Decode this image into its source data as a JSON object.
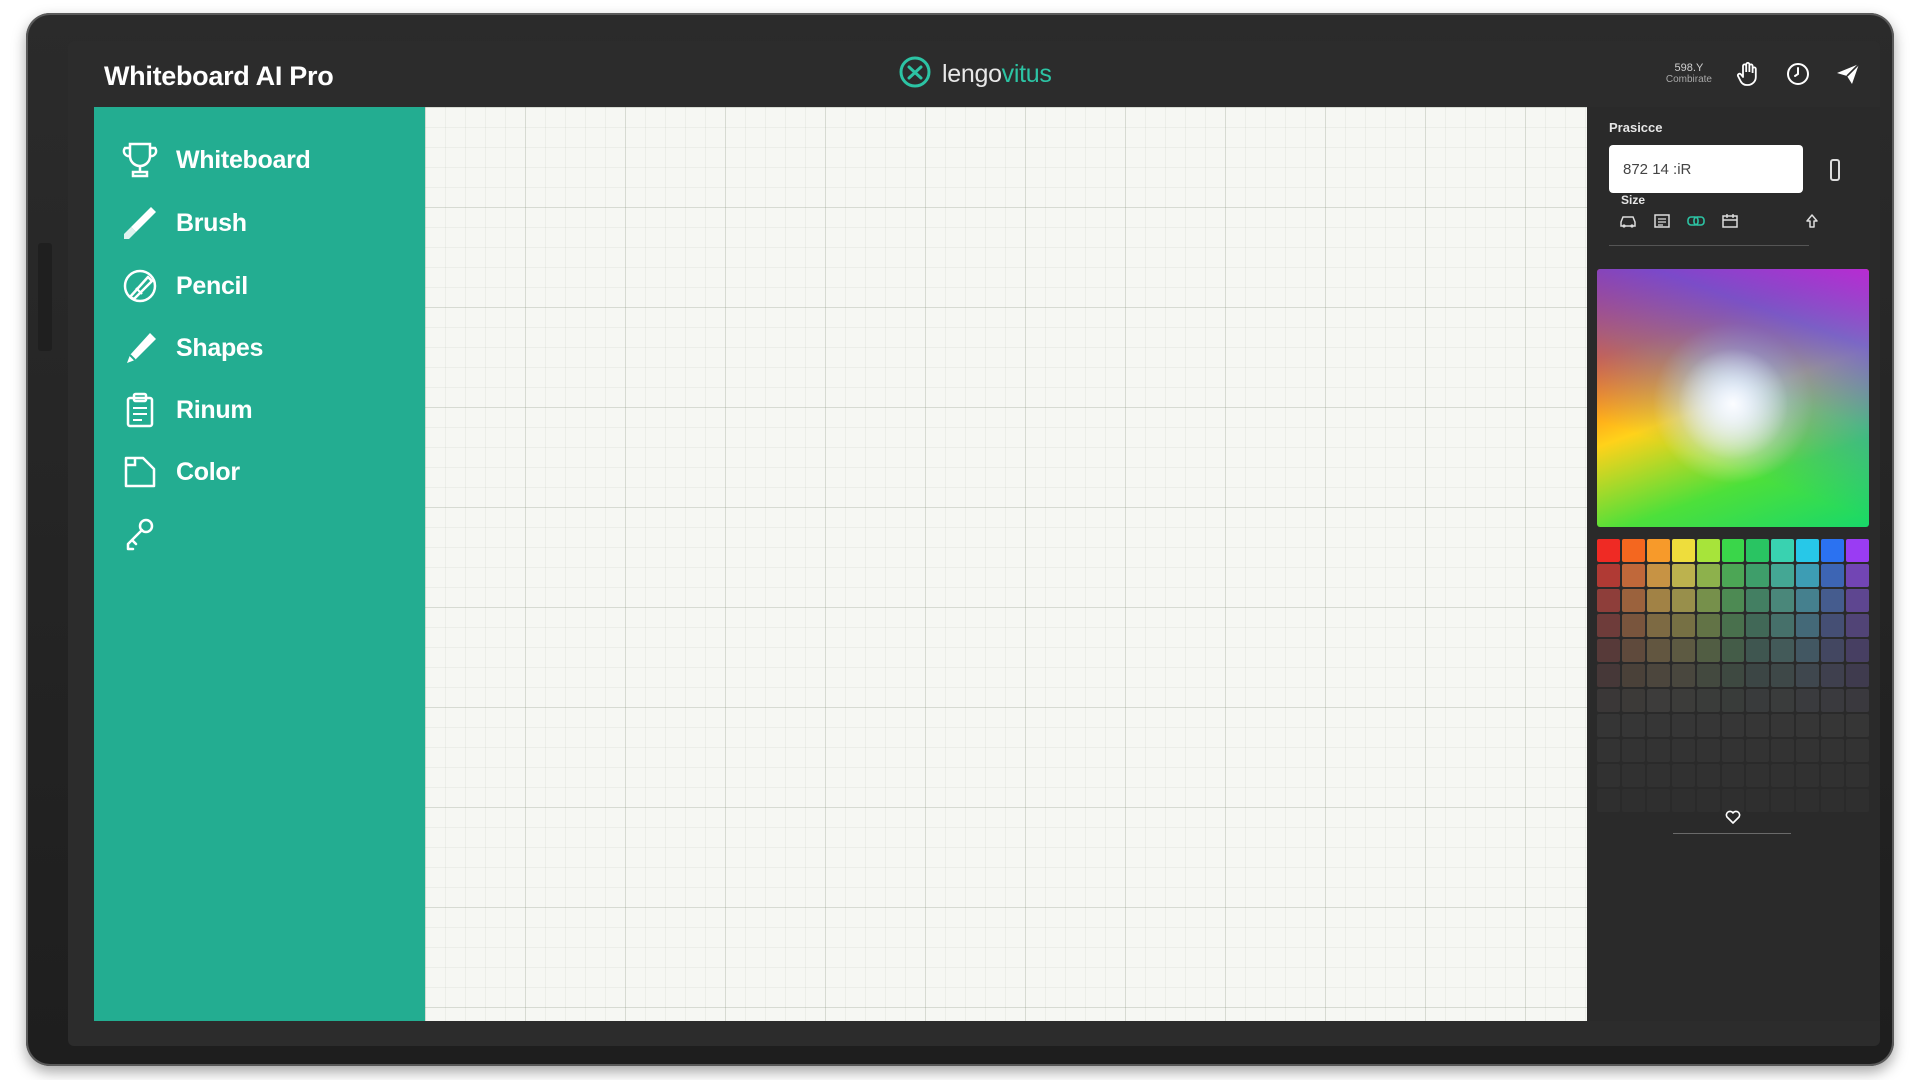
{
  "header": {
    "title": "Whiteboard AI Pro",
    "brand": {
      "name_part1": "lengo",
      "name_part2": "vitus"
    },
    "status": {
      "top": "598.Y",
      "bottom": "Combirate"
    },
    "icons": [
      "hand-icon",
      "clock-icon",
      "send-icon"
    ]
  },
  "sidebar": {
    "background": "#23ad91",
    "items": [
      {
        "label": "Whiteboard",
        "icon": "trophy-icon"
      },
      {
        "label": "Brush",
        "icon": "brush-icon"
      },
      {
        "label": "Pencil",
        "icon": "pencil-icon"
      },
      {
        "label": "Shapes",
        "icon": "shapes-icon"
      },
      {
        "label": "Rinum",
        "icon": "clipboard-icon"
      },
      {
        "label": "Color",
        "icon": "color-icon"
      },
      {
        "label": "",
        "icon": "key-icon"
      }
    ]
  },
  "panel": {
    "value_label": "Prasicce",
    "value_input": "872 14 :iR",
    "size_label": "Size",
    "size_tools": [
      "car-icon",
      "text-block-icon",
      "link-icon",
      "calendar-icon",
      "upload-icon"
    ],
    "selected_size_tool": "link-icon",
    "palette": {
      "rows": [
        [
          "#ef2a24",
          "#f4671f",
          "#f79a2a",
          "#eedd3c",
          "#a7e43a",
          "#3ad64a",
          "#29c462",
          "#39d2b0",
          "#27c8e8",
          "#2b72f1",
          "#9a3cf3"
        ],
        [
          "#b03a34",
          "#c0683a",
          "#c79344",
          "#bcb24e",
          "#8db14c",
          "#4ca655",
          "#3e9e6a",
          "#44a794",
          "#3d9db4",
          "#3d65b4",
          "#7245b4"
        ],
        [
          "#8e3e3a",
          "#9b623d",
          "#a18245",
          "#988f4b",
          "#76904b",
          "#4d8a53",
          "#437f62",
          "#4a877a",
          "#45808e",
          "#455c8e",
          "#5e4690"
        ],
        [
          "#6e3c3a",
          "#79553d",
          "#7d6a43",
          "#767044",
          "#627346",
          "#49704d",
          "#416857",
          "#46706a",
          "#446978",
          "#454f74",
          "#514476"
        ],
        [
          "#573a39",
          "#5f4a3c",
          "#625640",
          "#5d5a42",
          "#515d43",
          "#445c48",
          "#3f5650",
          "#435a59",
          "#425762",
          "#434761",
          "#473f62"
        ],
        [
          "#463838",
          "#4a4139",
          "#4c463d",
          "#49473e",
          "#43493f",
          "#3e4941",
          "#3c4645",
          "#3e4848",
          "#3f474e",
          "#3f404e",
          "#3f3b4e"
        ],
        [
          "#3a3737",
          "#3c3a38",
          "#3d3c3b",
          "#3c3c3a",
          "#3a3c3a",
          "#393c3a",
          "#393b3c",
          "#3a3c3c",
          "#3a3b3e",
          "#3a3a3e",
          "#3a393e"
        ],
        [
          "#353535",
          "#363636",
          "#363636",
          "#363636",
          "#363636",
          "#363636",
          "#363636",
          "#363636",
          "#363636",
          "#363636",
          "#363636"
        ],
        [
          "#333333",
          "#333333",
          "#333333",
          "#333333",
          "#333333",
          "#333333",
          "#333333",
          "#333333",
          "#333333",
          "#333333",
          "#333333"
        ],
        [
          "#313131",
          "#313131",
          "#313131",
          "#313131",
          "#313131",
          "#313131",
          "#313131",
          "#313131",
          "#313131",
          "#313131",
          "#313131"
        ],
        [
          "#2f2f2f",
          "#2f2f2f",
          "#2f2f2f",
          "#2f2f2f",
          "#2f2f2f",
          "#2f2f2f",
          "#2f2f2f",
          "#2f2f2f",
          "#2f2f2f",
          "#2f2f2f",
          "#2f2f2f"
        ]
      ]
    }
  },
  "colors": {
    "accent": "#23ad91",
    "frame": "#2c2c2c",
    "canvas": "#f6f7f3"
  }
}
